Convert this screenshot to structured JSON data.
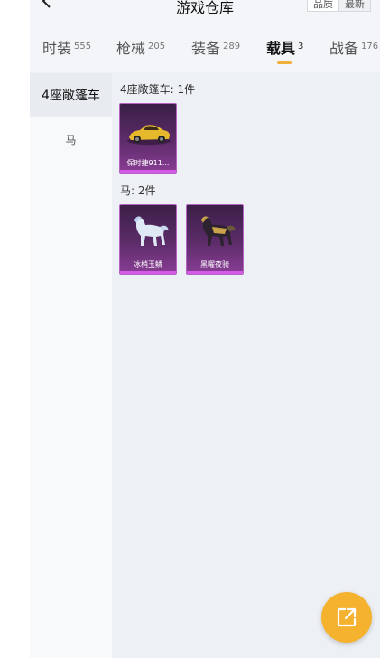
{
  "header": {
    "title": "游戏仓库",
    "sort_quality": "品质",
    "sort_latest": "最新"
  },
  "tabs": [
    {
      "label": "时装",
      "count": "555"
    },
    {
      "label": "枪械",
      "count": "205"
    },
    {
      "label": "装备",
      "count": "289"
    },
    {
      "label": "载具",
      "count": "3"
    },
    {
      "label": "战备",
      "count": "176"
    }
  ],
  "active_tab": "载具",
  "sidebar": {
    "items": [
      {
        "label": "4座敞篷车"
      },
      {
        "label": "马"
      }
    ]
  },
  "groups": [
    {
      "title": "4座敞篷车: 1件",
      "items": [
        {
          "name": "保时捷911...",
          "icon": "car-icon"
        }
      ]
    },
    {
      "title": "马: 2件",
      "items": [
        {
          "name": "冰梢玉鳞",
          "icon": "horse-icon"
        },
        {
          "name": "黑曜夜骑",
          "icon": "horse-icon"
        }
      ]
    }
  ],
  "colors": {
    "accent": "#f5b22f",
    "card_purple": "#5d2c6a",
    "tab_underline": "#f2b13c"
  }
}
